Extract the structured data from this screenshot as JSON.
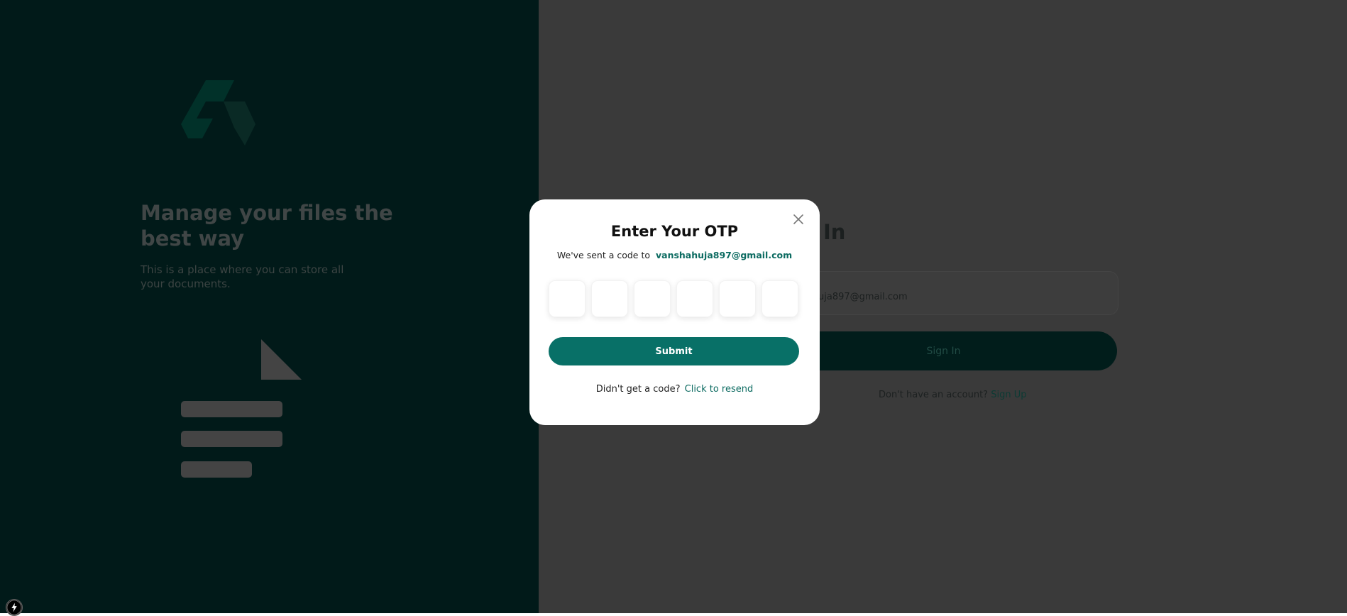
{
  "hero": {
    "title": "Manage your files the best way",
    "subtitle": "This is a place where you can store all your documents."
  },
  "signin": {
    "title_partial": "In",
    "email_partial": "uja897@gmail.com",
    "button_label": "Sign In",
    "no_account_text": "Don't have an account?",
    "signup_link": "Sign Up"
  },
  "otp_modal": {
    "title": "Enter Your OTP",
    "sent_text": "We've sent a code to",
    "email": "vanshahuja897@gmail.com",
    "digits": [
      "",
      "",
      "",
      "",
      "",
      ""
    ],
    "submit_label": "Submit",
    "resend_prompt": "Didn't get a code?",
    "resend_link": "Click to resend"
  },
  "icons": {
    "close": "close-icon",
    "logo": "logo-icon",
    "document": "document-illustration",
    "dev": "lightning-icon"
  },
  "colors": {
    "accent": "#087067",
    "left_panel": "#011a19",
    "overlay": "#3a3a3a"
  }
}
